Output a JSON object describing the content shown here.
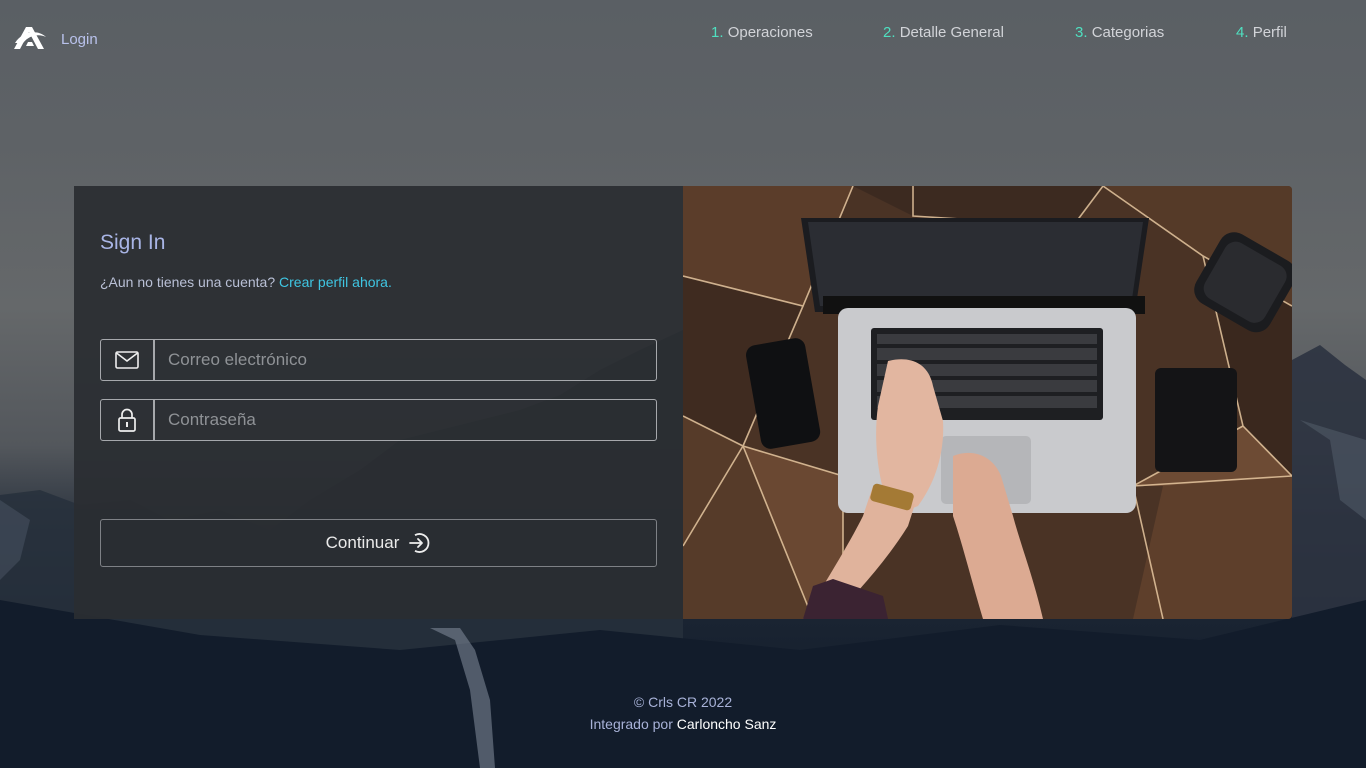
{
  "header": {
    "brand": "Login",
    "nav": [
      {
        "num": "1.",
        "label": "Operaciones"
      },
      {
        "num": "2.",
        "label": "Detalle General"
      },
      {
        "num": "3.",
        "label": "Categorias"
      },
      {
        "num": "4.",
        "label": "Perfil"
      }
    ]
  },
  "signin": {
    "title": "Sign In",
    "prompt": "¿Aun no tienes una cuenta?",
    "create_link": "Crear perfil ahora.",
    "email_placeholder": "Correo electrónico",
    "password_placeholder": "Contraseña",
    "submit_label": "Continuar"
  },
  "footer": {
    "copyright": "© Crls CR 2022",
    "integrated_by": "Integrado por",
    "author": "Carloncho Sanz"
  },
  "colors": {
    "accent": "#3fc6e3",
    "nav_number": "#4fe0c0",
    "panel": "#2a2d32"
  },
  "icons": [
    "logo-icon",
    "mail-icon",
    "lock-icon",
    "login-arrow-icon"
  ]
}
